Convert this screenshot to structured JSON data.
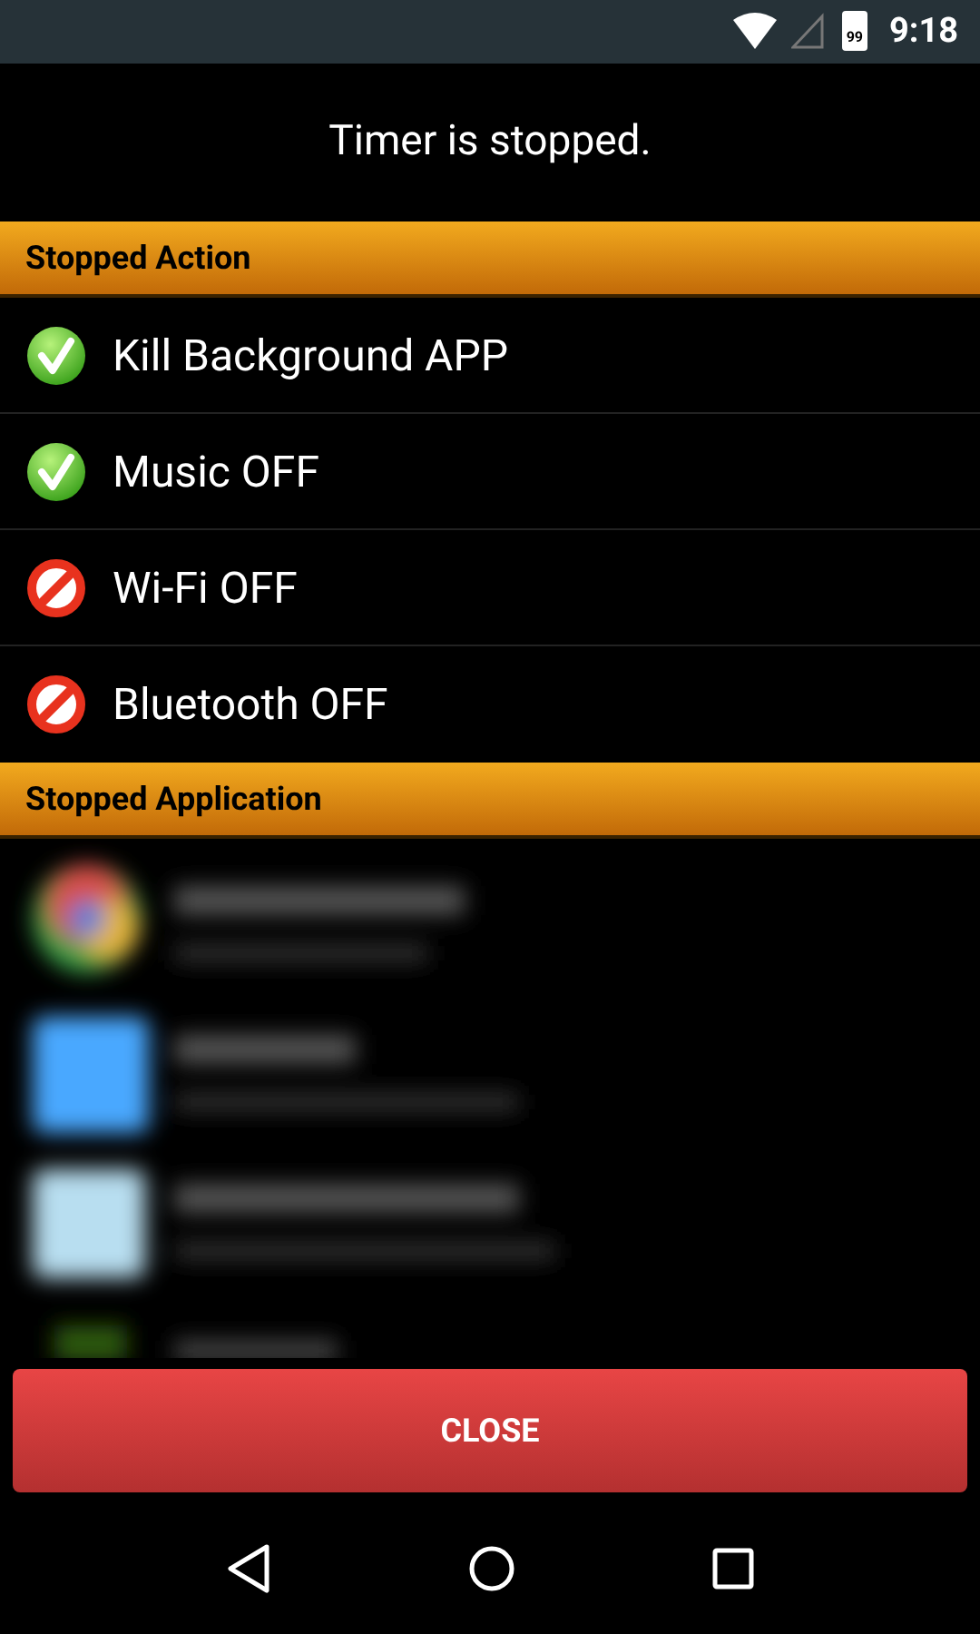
{
  "status_bar": {
    "battery": "99",
    "time": "9:18"
  },
  "message": "Timer is stopped.",
  "sections": [
    {
      "title": "Stopped Action",
      "kind": "actions",
      "items": [
        {
          "label": "Kill Background APP",
          "enabled": true
        },
        {
          "label": "Music OFF",
          "enabled": true
        },
        {
          "label": "Wi-Fi OFF",
          "enabled": false
        },
        {
          "label": "Bluetooth OFF",
          "enabled": false
        }
      ]
    },
    {
      "title": "Stopped Application",
      "kind": "apps"
    }
  ],
  "close_button": "CLOSE"
}
